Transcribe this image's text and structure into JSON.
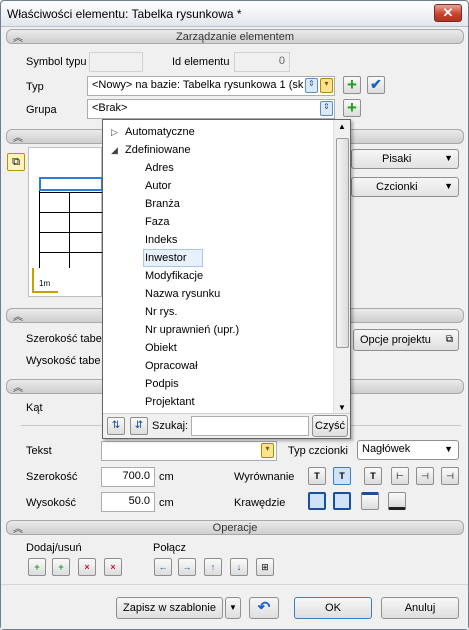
{
  "window": {
    "title": "Właściwości elementu: Tabelka rysunkowa *",
    "close": "✕"
  },
  "sections": {
    "manage": "Zarządzanie elementem",
    "operations": "Operacje"
  },
  "manage": {
    "symbol_label": "Symbol typu",
    "symbol_value": "",
    "id_label": "Id elementu",
    "id_value": "0",
    "type_label": "Typ",
    "type_value": "<Nowy> na bazie: Tabelka rysunkowa 1 (sk",
    "group_label": "Grupa",
    "group_value": "<Brak>"
  },
  "dropdown": {
    "groups": [
      {
        "label": "Automatyczne",
        "expander": "▷"
      },
      {
        "label": "Zdefiniowane",
        "expander": "◢"
      }
    ],
    "items": [
      "Adres",
      "Autor",
      "Branża",
      "Faza",
      "Indeks",
      "Inwestor",
      "Modyfikacje",
      "Nazwa rysunku",
      "Nr rys.",
      "Nr uprawnień (upr.)",
      "Obiekt",
      "Opracował",
      "Podpis",
      "Projektant"
    ],
    "selected": "Inwestor",
    "search_label": "Szukaj:",
    "search_value": "",
    "clear_button": "Czyść"
  },
  "preview": {
    "scale_label": "1m"
  },
  "right_buttons": {
    "pisaki": "Pisaki",
    "czcionki": "Czcionki",
    "opcje": "Opcje projektu"
  },
  "sizes": {
    "width_label": "Szerokość tabe",
    "height_label": "Wysokość tabe",
    "angle_label": "Kąt"
  },
  "cell": {
    "text_label": "Tekst",
    "text_value": "",
    "font_type_label": "Typ czcionki",
    "font_type_value": "Nagłówek",
    "width_label": "Szerokość",
    "width_value": "700.0",
    "width_unit": "cm",
    "height_label": "Wysokość",
    "height_value": "50.0",
    "height_unit": "cm",
    "align_label": "Wyrównanie",
    "borders_label": "Krawędzie"
  },
  "operations": {
    "addremove_label": "Dodaj/usuń",
    "merge_label": "Połącz"
  },
  "footer": {
    "save_template": "Zapisz w szablonie",
    "ok": "OK",
    "cancel": "Anuluj"
  }
}
